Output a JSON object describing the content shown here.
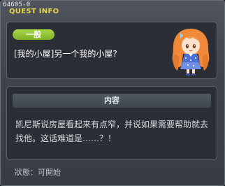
{
  "window": {
    "quest_id": "64605-0",
    "title": "QUEST INFO"
  },
  "summary": {
    "category": "一般",
    "quest_name": "[我的小屋]另一个我的小屋?",
    "npc_icon": "npc-portrait-icon"
  },
  "detail": {
    "header": "内容",
    "text": "凯尼斯说房屋看起来有点窄，并说如果需要帮助就去找他。这话难道是……？！"
  },
  "status": {
    "text": "狀態：可開始"
  },
  "colors": {
    "title": "#e6d64a",
    "badge": "#8fc13a",
    "panel": "#2b2f35"
  }
}
